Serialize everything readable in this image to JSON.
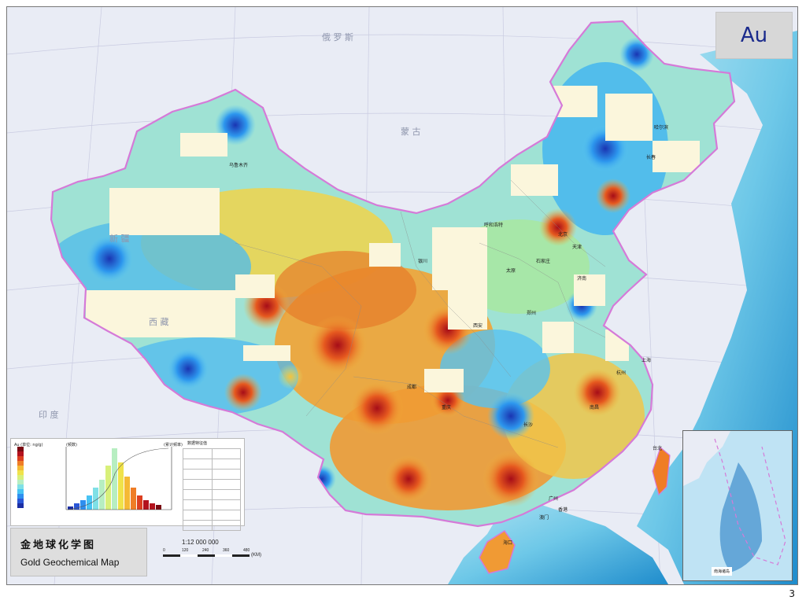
{
  "element_symbol": "Au",
  "page_number": "3",
  "map": {
    "title_cn": "金地球化学图",
    "title_en": "Gold Geochemical Map",
    "scale_ratio": "1:12 000 000",
    "scale_ticks": [
      "0",
      "120",
      "240",
      "360",
      "480"
    ],
    "scale_unit": "(KM)"
  },
  "legend": {
    "unit_label": "Au (单位: ng/g)",
    "left_axis_label": "(频数)",
    "right_axis_label": "(累计频率)",
    "stats_title": "数据特征值",
    "colors": [
      "#1c2fa4",
      "#2a56d6",
      "#2e8ff0",
      "#48c3f4",
      "#7fe0e6",
      "#b7eec1",
      "#d8f07a",
      "#f0e24a",
      "#f5b935",
      "#ef7d26",
      "#dc3f20",
      "#b3121d",
      "#7a0a12"
    ]
  },
  "places": {
    "harbin": "哈尔滨",
    "changchun": "长春",
    "beijing": "北京",
    "tianjin": "天津",
    "shijiazhuang": "石家庄",
    "taiyuan": "太原",
    "jinan": "济南",
    "zhengzhou": "郑州",
    "shanghai": "上海",
    "hangzhou": "杭州",
    "nanchang": "南昌",
    "changsha": "长沙",
    "chengdu": "成都",
    "chongqing": "重庆",
    "guangzhou": "广州",
    "xianggang": "香港",
    "aomen": "澳门",
    "haikou": "海口",
    "taibei": "台北",
    "wulumuqi": "乌鲁木齐",
    "huhehaote": "呼和浩特",
    "yinchuan": "银川",
    "xian": "西安"
  },
  "countries": {
    "mongolia": "蒙  古",
    "russia": "俄  罗  斯",
    "india": "印  度",
    "xinjiang": "新  疆",
    "xizang": "西  藏"
  },
  "inset_label": "南海诸岛"
}
